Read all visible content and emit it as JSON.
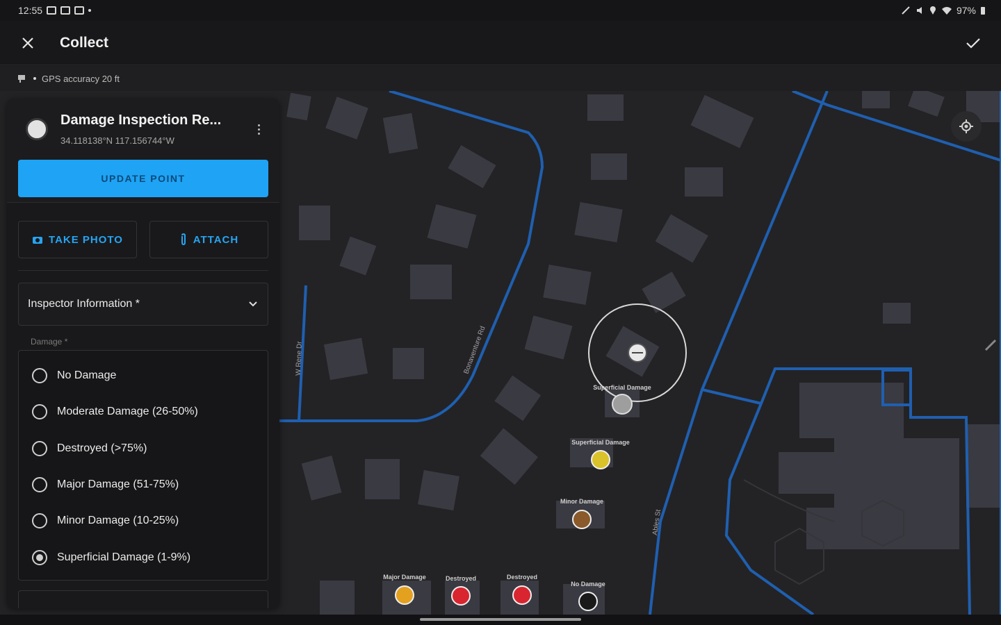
{
  "status_bar": {
    "time": "12:55",
    "battery": "97%"
  },
  "app_bar": {
    "title": "Collect"
  },
  "gps": {
    "accuracy_text": "GPS accuracy 20 ft"
  },
  "feature": {
    "title": "Damage Inspection Re...",
    "coordinates": "34.118138°N  117.156744°W",
    "update_label": "UPDATE POINT",
    "take_photo_label": "TAKE PHOTO",
    "attach_label": "ATTACH"
  },
  "form": {
    "group_label": "Inspector Information *",
    "damage_label": "Damage *",
    "options": [
      {
        "label": "No Damage",
        "selected": false
      },
      {
        "label": "Moderate Damage (26-50%)",
        "selected": false
      },
      {
        "label": "Destroyed (>75%)",
        "selected": false
      },
      {
        "label": "Major Damage (51-75%)",
        "selected": false
      },
      {
        "label": "Minor Damage (10-25%)",
        "selected": false
      },
      {
        "label": "Superficial Damage (1-9%)",
        "selected": true
      }
    ]
  },
  "map": {
    "streets": [
      "W Rene Dr",
      "Bonaventure Rd",
      "Ables St"
    ],
    "markers": [
      {
        "label": "Superficial Damage",
        "color": "#9e9e9e"
      },
      {
        "label": "Superficial Damage",
        "color": "#d9c22a"
      },
      {
        "label": "Minor Damage",
        "color": "#8a5a2a"
      },
      {
        "label": "Major Damage",
        "color": "#e3a11f"
      },
      {
        "label": "Destroyed",
        "color": "#d9252f"
      },
      {
        "label": "Destroyed",
        "color": "#d9252f"
      },
      {
        "label": "No Damage",
        "color": "#1a1a1a"
      }
    ],
    "road_color": "#1f5fb0",
    "building_color": "#3a3a42"
  }
}
